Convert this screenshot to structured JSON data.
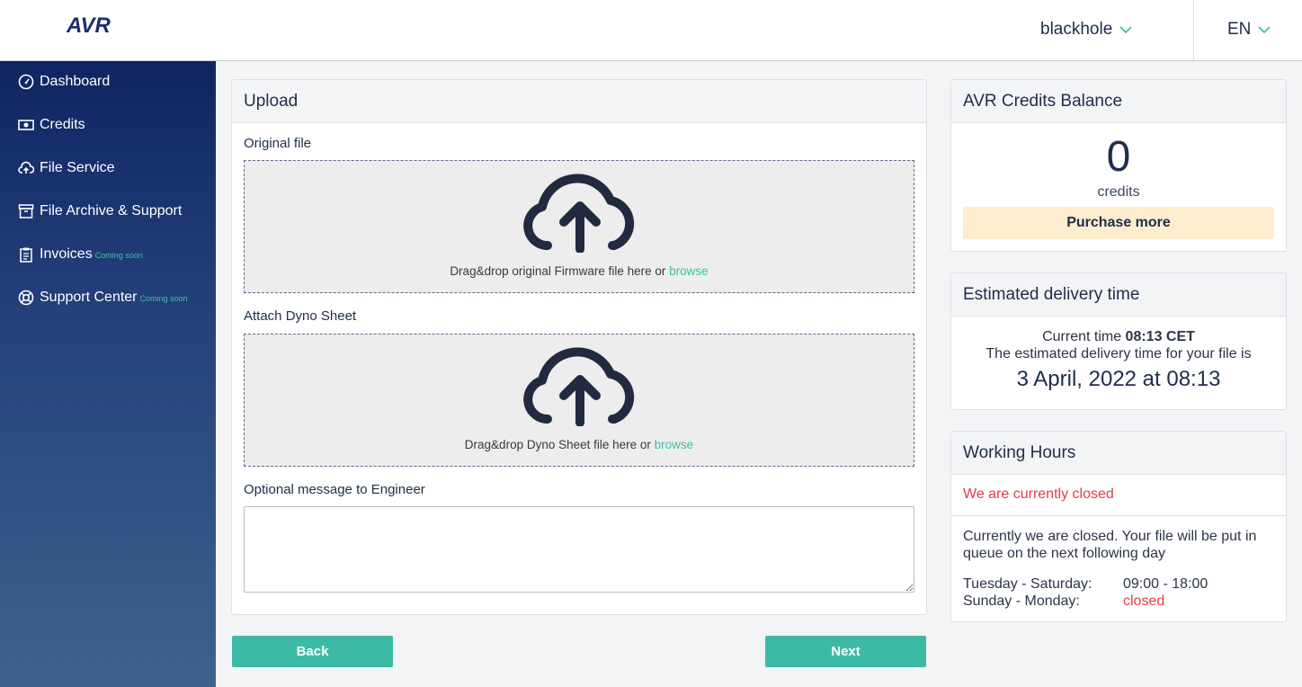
{
  "header": {
    "logo_text": "AVR",
    "user": "blackhole",
    "language": "EN"
  },
  "sidebar": {
    "items": [
      {
        "label": "Dashboard",
        "icon": "gauge-icon",
        "badge": ""
      },
      {
        "label": "Credits",
        "icon": "money-icon",
        "badge": ""
      },
      {
        "label": "File Service",
        "icon": "cloud-upload-icon",
        "badge": ""
      },
      {
        "label": "File Archive & Support",
        "icon": "archive-icon",
        "badge": ""
      },
      {
        "label": "Invoices",
        "icon": "clipboard-icon",
        "badge": "Coming soon"
      },
      {
        "label": "Support Center",
        "icon": "lifebuoy-icon",
        "badge": "Coming soon"
      }
    ]
  },
  "upload": {
    "title": "Upload",
    "original_label": "Original file",
    "original_text": "Drag&drop original Firmware file here or ",
    "browse": "browse",
    "dyno_label": "Attach Dyno Sheet",
    "dyno_text": "Drag&drop Dyno Sheet file here or ",
    "message_label": "Optional message to Engineer",
    "message_value": ""
  },
  "buttons": {
    "back": "Back",
    "next": "Next"
  },
  "credits": {
    "title": "AVR Credits Balance",
    "value": "0",
    "unit": "credits",
    "purchase": "Purchase more"
  },
  "delivery": {
    "title": "Estimated delivery time",
    "current_prefix": "Current time ",
    "current_time": "08:13 CET",
    "estimate_text": "The estimated delivery time for your file is",
    "date": "3 April, 2022 at 08:13"
  },
  "working_hours": {
    "title": "Working Hours",
    "status": "We are currently closed",
    "description": "Currently we are closed. Your file will be put in queue on the next following day",
    "rows": [
      {
        "days": "Tuesday - Saturday:",
        "hours": "09:00 - 18:00"
      },
      {
        "days": "Sunday - Monday:",
        "hours": "closed"
      }
    ]
  },
  "colors": {
    "accent": "#3dbaa5",
    "navy": "#1f2d4a",
    "closed_red": "#e23b4a",
    "purchase_bg": "#fdeccd"
  }
}
